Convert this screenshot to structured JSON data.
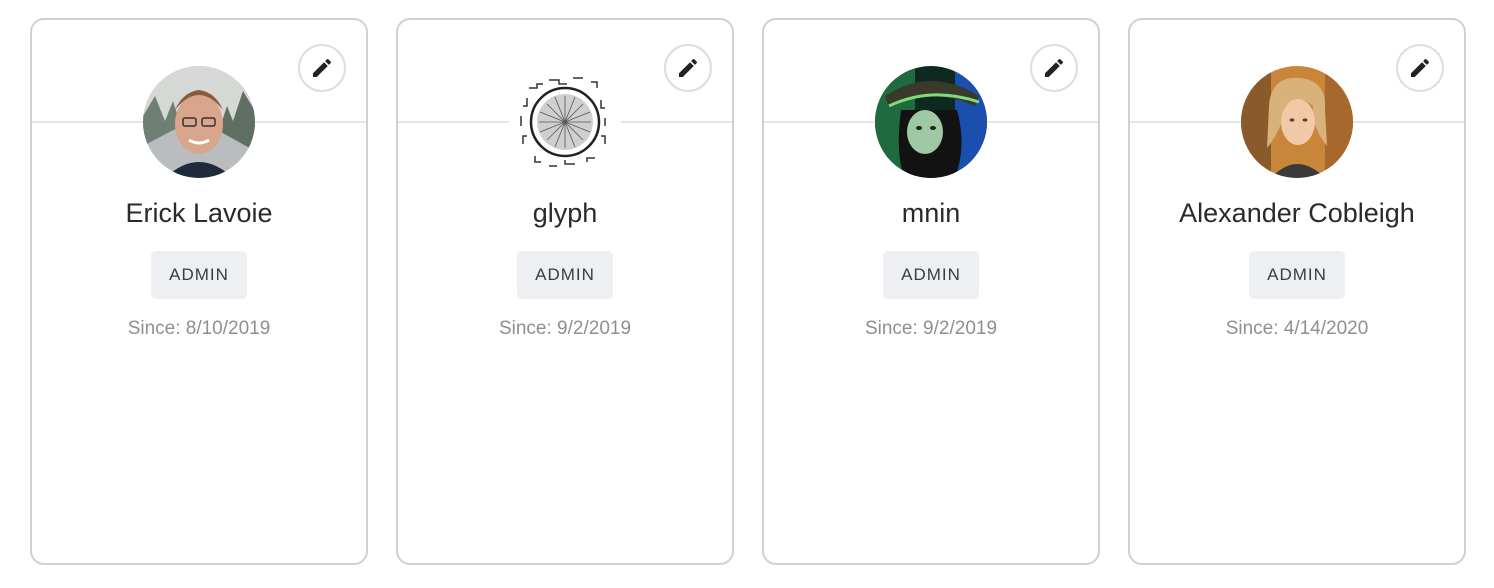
{
  "users": [
    {
      "name": "Erick Lavoie",
      "role": "ADMIN",
      "since": "Since: 8/10/2019",
      "avatar": "photo-avatar",
      "edit_icon": "pencil-icon"
    },
    {
      "name": "glyph",
      "role": "ADMIN",
      "since": "Since: 9/2/2019",
      "avatar": "glyph-avatar",
      "edit_icon": "pencil-icon"
    },
    {
      "name": "mnin",
      "role": "ADMIN",
      "since": "Since: 9/2/2019",
      "avatar": "photo-avatar",
      "edit_icon": "pencil-icon"
    },
    {
      "name": "Alexander Cobleigh",
      "role": "ADMIN",
      "since": "Since: 4/14/2020",
      "avatar": "photo-avatar",
      "edit_icon": "pencil-icon"
    }
  ],
  "colors": {
    "card_border": "#cfd0d4",
    "badge_bg": "#eeeff2",
    "name_text": "#2a2a2e",
    "since_text": "#8e8f94"
  }
}
